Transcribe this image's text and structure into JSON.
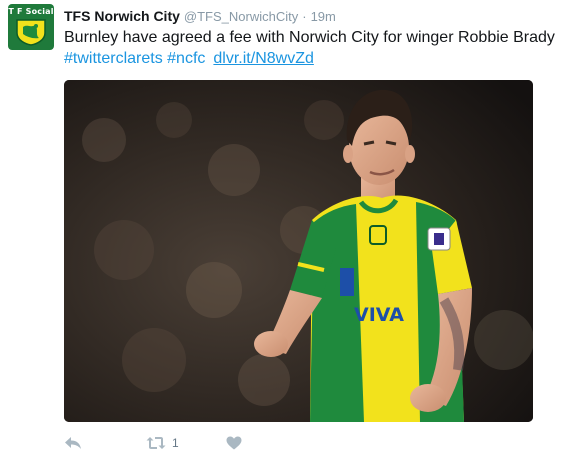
{
  "account": {
    "avatar_text": "T F Social",
    "display_name": "TFS Norwich City",
    "handle": "@TFS_NorwichCity",
    "separator": "·",
    "time": "19m"
  },
  "tweet": {
    "text_line1": "Burnley have agreed a fee with Norwich City for winger Robbie Brady",
    "hashtags": [
      "#twitterclarets",
      "#ncfc"
    ],
    "link": "dlvr.it/N8wvZd"
  },
  "media": {
    "shirt_sponsor": "VIVA"
  },
  "actions": {
    "retweet_count": "1"
  },
  "colors": {
    "link_blue": "#1b95e0",
    "icon_grey": "#aab8c2",
    "kit_yellow": "#f2e21c",
    "kit_green": "#1f8a3d"
  },
  "icons": [
    "reply-icon",
    "retweet-icon",
    "like-icon"
  ]
}
